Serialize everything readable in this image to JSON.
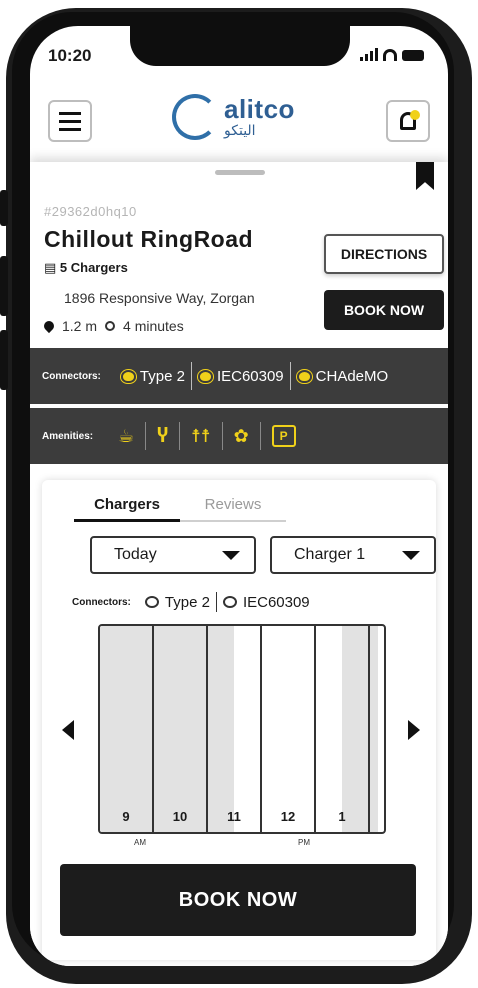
{
  "status": {
    "time": "10:20"
  },
  "station": {
    "id": "#29362d0hq10",
    "name": "Chillout RingRoad",
    "chargers": "5 Chargers",
    "address": "1896 Responsive Way, Zorgan",
    "distance": "1.2 m",
    "eta": "4 minutes"
  },
  "actions": {
    "directions": "DIRECTIONS",
    "book_now": "BOOK NOW"
  },
  "connectors": {
    "label": "Connectors:",
    "items": [
      "Type 2",
      "IEC60309",
      "CHAdeMO"
    ]
  },
  "amenities": {
    "label": "Amenities:",
    "icons": [
      "coffee-icon",
      "restaurant-icon",
      "restroom-icon",
      "garden-icon",
      "parking-icon"
    ],
    "parking_letter": "P"
  },
  "logo": {
    "en": "alitco",
    "ar": "اليتكو"
  },
  "tabs": [
    "Chargers",
    "Reviews"
  ],
  "filters": {
    "day": "Today",
    "charger": "Charger 1"
  },
  "charger_connectors": {
    "label": "Connectors:",
    "items": [
      "Type 2",
      "IEC60309"
    ]
  },
  "timeline": {
    "slots": [
      "9",
      "10",
      "11",
      "12",
      "1"
    ],
    "am": "AM",
    "pm": "PM"
  },
  "colors": {
    "accent": "#f0d11a",
    "dark": "#1c1c1c",
    "bar": "#3c3c3c"
  }
}
